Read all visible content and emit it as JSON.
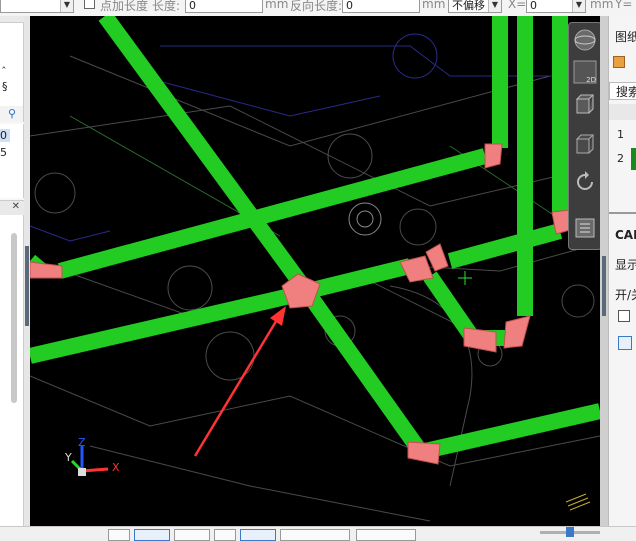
{
  "toolbar": {
    "first_field_value": "",
    "point_length_checkbox_label": "点加长度",
    "length_label": "长度:",
    "length_value": "0",
    "length_unit": "mm",
    "reverse_length_label": "反向长度:",
    "reverse_length_value": "0",
    "reverse_length_unit": "mm",
    "offset_mode_value": "不偏移",
    "x_label": "X=",
    "x_value": "0",
    "x_unit": "mm",
    "y_label": "Y="
  },
  "left_panel": {
    "row_values": [
      "0",
      "5"
    ],
    "top_symbols": [
      "‸",
      "§"
    ]
  },
  "right_panel": {
    "top_tab_label": "图纸",
    "search_label": "搜索",
    "rows": [
      "1",
      "2"
    ],
    "cad_tab_label": "CAI",
    "display_label": "显示",
    "onoff_label": "开/关"
  },
  "viewport": {
    "background": "#000000",
    "pipe_color": "#22cc22",
    "joint_color": "#f08080",
    "arrow_color": "#ff3333",
    "axis_labels": {
      "x": "X",
      "y": "Y",
      "z": "Z"
    },
    "view_cube_label": "2D"
  },
  "statusbar": {
    "buttons_count_hint": ""
  }
}
